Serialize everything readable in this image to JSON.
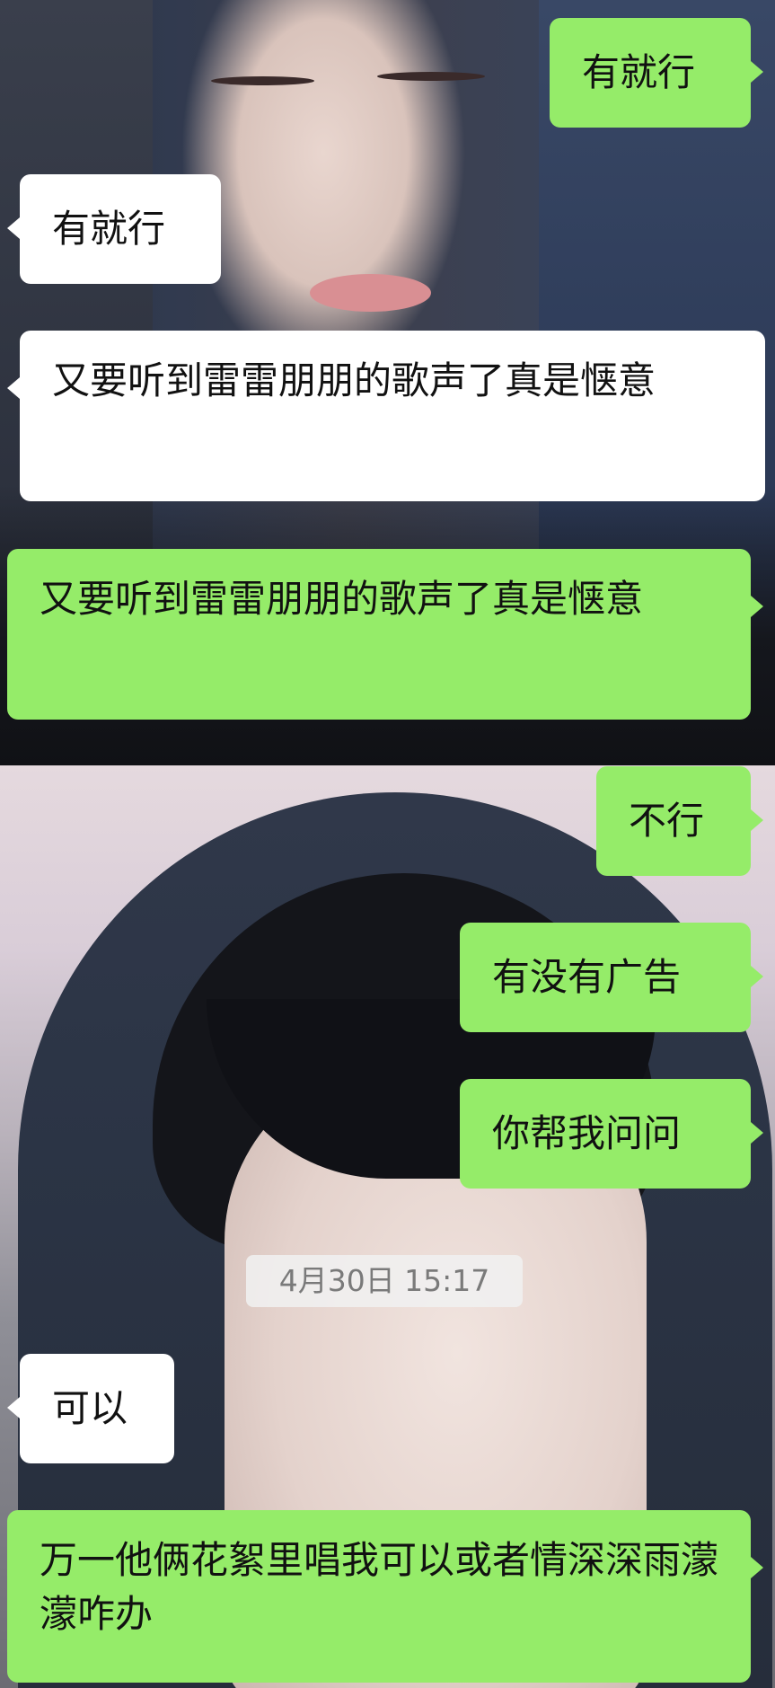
{
  "chat": {
    "timestamp": "4月30日 15:17",
    "messages": [
      {
        "side": "right",
        "text": "有就行"
      },
      {
        "side": "left",
        "text": "有就行"
      },
      {
        "side": "left",
        "text": "又要听到雷雷朋朋的歌声了真是惬意"
      },
      {
        "side": "right",
        "text": "又要听到雷雷朋朋的歌声了真是惬意"
      },
      {
        "side": "right",
        "text": "不行"
      },
      {
        "side": "right",
        "text": "有没有广告"
      },
      {
        "side": "right",
        "text": "你帮我问问"
      },
      {
        "side": "left",
        "text": "可以"
      },
      {
        "side": "right",
        "text": "万一他俩花絮里唱我可以或者情深深雨濛濛咋办"
      }
    ]
  },
  "colors": {
    "outgoing_bubble": "#95ec69",
    "incoming_bubble": "#ffffff",
    "timestamp_bg": "#f0f0f0",
    "timestamp_text": "#7a7a7a"
  }
}
